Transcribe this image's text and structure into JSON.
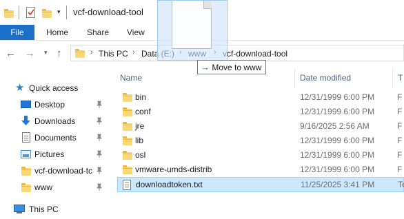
{
  "window": {
    "title": "vcf-download-tool"
  },
  "ribbon": {
    "tabs": [
      "File",
      "Home",
      "Share",
      "View"
    ]
  },
  "address": {
    "crumbs": [
      "This PC",
      "Data (E:)",
      "www",
      "vcf-download-tool"
    ]
  },
  "drag": {
    "tooltip": "Move to www"
  },
  "navpane": {
    "quick_access": "Quick access",
    "items": [
      {
        "label": "Desktop",
        "icon": "desktop-icon",
        "pinned": true
      },
      {
        "label": "Downloads",
        "icon": "download-arrow-icon",
        "pinned": true
      },
      {
        "label": "Documents",
        "icon": "documents-icon",
        "pinned": true
      },
      {
        "label": "Pictures",
        "icon": "pictures-icon",
        "pinned": true
      },
      {
        "label": "vcf-download-tc",
        "icon": "folder-icon",
        "pinned": true
      },
      {
        "label": "www",
        "icon": "folder-icon",
        "pinned": true
      }
    ],
    "this_pc": "This PC"
  },
  "filelist": {
    "columns": [
      "Name",
      "Date modified",
      "T"
    ],
    "rows": [
      {
        "name": "bin",
        "date": "12/31/1999 6:00 PM",
        "type": "F",
        "kind": "folder"
      },
      {
        "name": "conf",
        "date": "12/31/1999 6:00 PM",
        "type": "F",
        "kind": "folder"
      },
      {
        "name": "jre",
        "date": "9/16/2025 2:56 AM",
        "type": "F",
        "kind": "folder"
      },
      {
        "name": "lib",
        "date": "12/31/1999 6:00 PM",
        "type": "F",
        "kind": "folder"
      },
      {
        "name": "osl",
        "date": "12/31/1999 6:00 PM",
        "type": "F",
        "kind": "folder"
      },
      {
        "name": "vmware-umds-distrib",
        "date": "12/31/1999 6:00 PM",
        "type": "F",
        "kind": "folder"
      },
      {
        "name": "downloadtoken.txt",
        "date": "11/25/2025 3:41 PM",
        "type": "Te",
        "kind": "file",
        "selected": true
      }
    ]
  },
  "colors": {
    "accent": "#1a6fc9",
    "folder": "#f8d775",
    "selection": "#cce8ff"
  }
}
